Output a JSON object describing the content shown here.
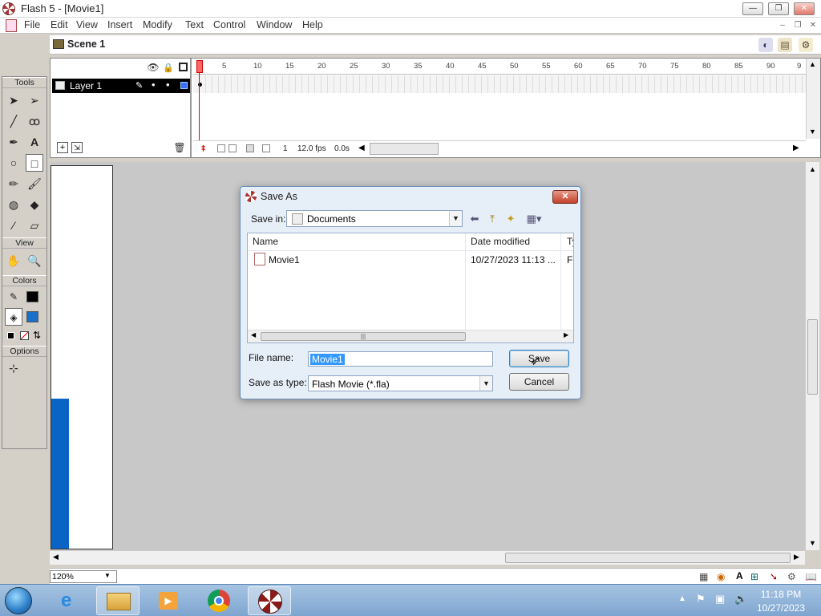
{
  "window": {
    "title": "Flash 5 - [Movie1]",
    "controls": {
      "minimize": "—",
      "restore": "❐",
      "close": "✕"
    }
  },
  "menu": {
    "items": [
      "File",
      "Edit",
      "View",
      "Insert",
      "Modify",
      "Text",
      "Control",
      "Window",
      "Help"
    ],
    "mdi_controls": {
      "minimize": "–",
      "restore": "❐",
      "close": "✕"
    }
  },
  "scene": {
    "label": "Scene 1"
  },
  "toolbox": {
    "tools_header": "Tools",
    "view_header": "View",
    "colors_header": "Colors",
    "options_header": "Options",
    "stroke_color": "#000000",
    "fill_color": "#1a6fcc"
  },
  "timeline": {
    "layer_name": "Layer 1",
    "ruler_numbers": [
      "1",
      "5",
      "10",
      "15",
      "20",
      "25",
      "30",
      "35",
      "40",
      "45",
      "50",
      "55",
      "60",
      "65",
      "70",
      "75",
      "80",
      "85",
      "90",
      "9"
    ],
    "current_frame": "1",
    "frame_rate": "12.0 fps",
    "elapsed": "0.0s"
  },
  "stage": {
    "zoom": "120%",
    "shape_color": "#0a64c6"
  },
  "dialog": {
    "title": "Save As",
    "save_in_label": "Save in:",
    "save_in_value": "Documents",
    "columns": {
      "name": "Name",
      "date": "Date modified",
      "type": "Ty"
    },
    "files": [
      {
        "name": "Movie1",
        "date": "10/27/2023 11:13 ...",
        "type": "Fl"
      }
    ],
    "file_name_label": "File name:",
    "file_name_value": "Movie1",
    "save_as_type_label": "Save as type:",
    "save_as_type_value": "Flash Movie (*.fla)",
    "save_button": "Save",
    "cancel_button": "Cancel",
    "close_glyph": "✕"
  },
  "taskbar": {
    "time": "11:18 PM",
    "date": "10/27/2023"
  }
}
